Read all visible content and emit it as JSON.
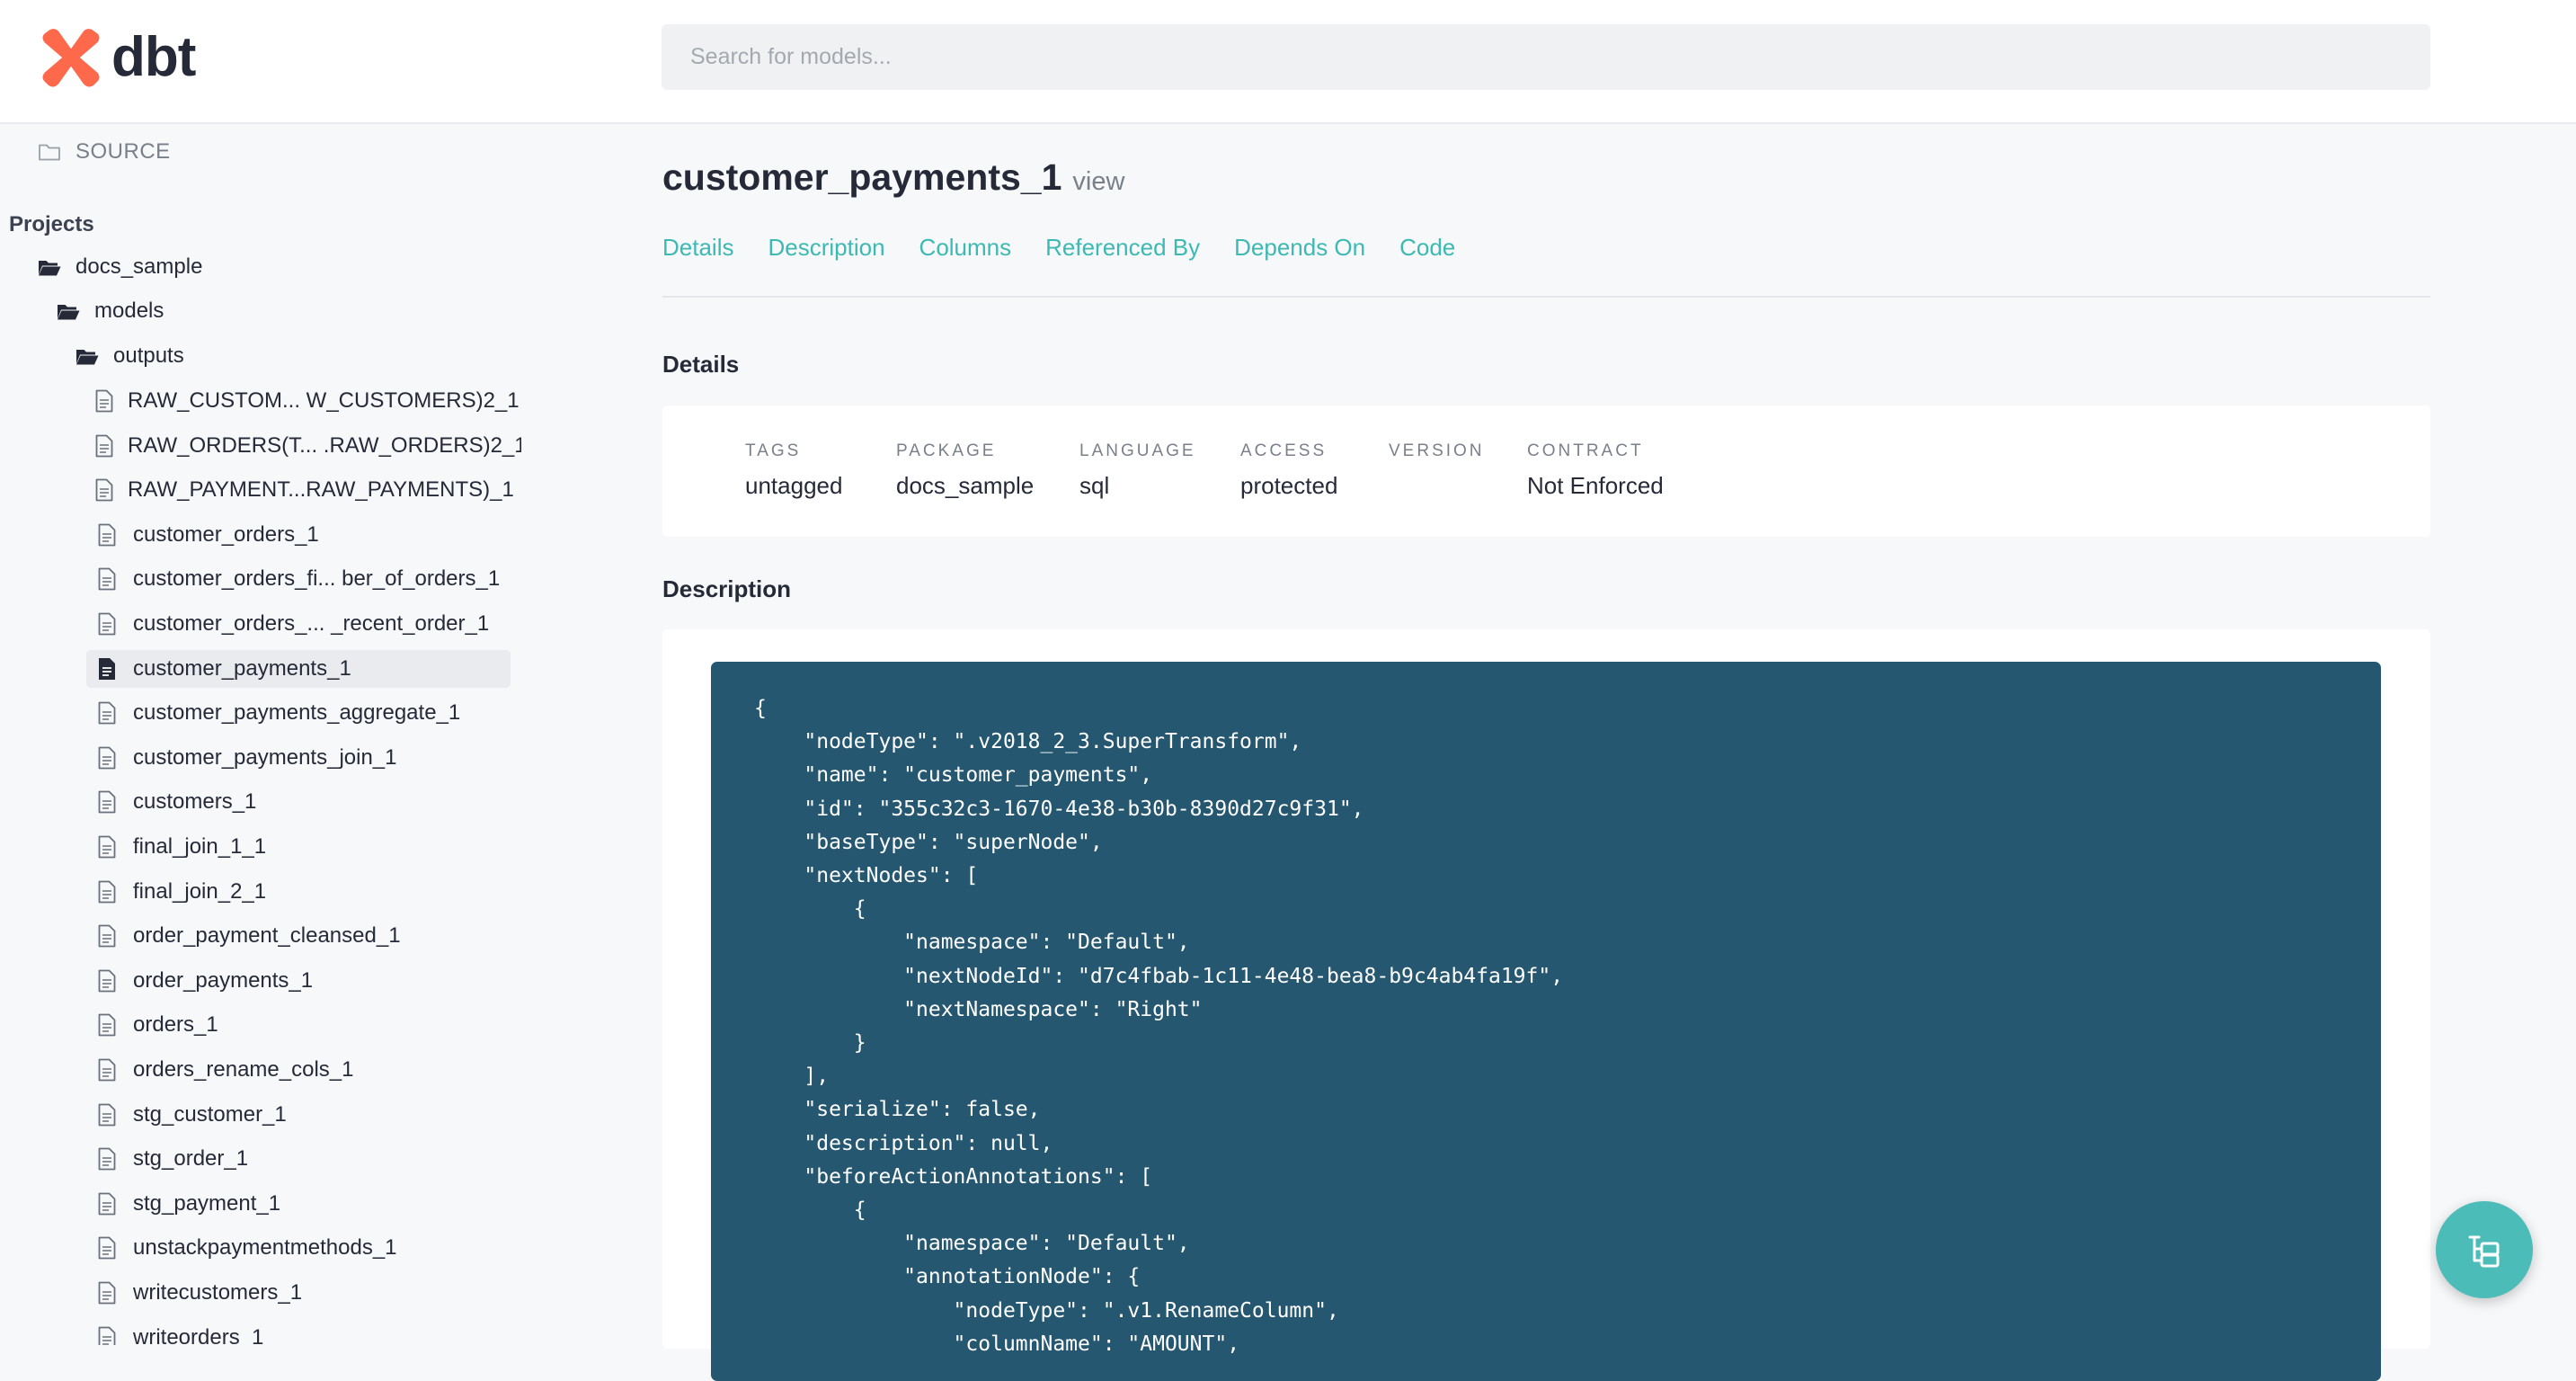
{
  "app": {
    "logo_text": "dbt",
    "brand_color": "#ff694b",
    "accent_color": "#3db9b4"
  },
  "search": {
    "placeholder": "Search for models..."
  },
  "sidebar": {
    "source_label": "SOURCE",
    "projects_heading": "Projects",
    "project_name": "docs_sample",
    "models_folder": "models",
    "outputs_folder": "outputs",
    "files": [
      "RAW_CUSTOM... W_CUSTOMERS)2_1",
      "RAW_ORDERS(T... .RAW_ORDERS)2_1",
      "RAW_PAYMENT...RAW_PAYMENTS)_1",
      "customer_orders_1",
      "customer_orders_fi... ber_of_orders_1",
      "customer_orders_...  _recent_order_1",
      "customer_payments_1",
      "customer_payments_aggregate_1",
      "customer_payments_join_1",
      "customers_1",
      "final_join_1_1",
      "final_join_2_1",
      "order_payment_cleansed_1",
      "order_payments_1",
      "orders_1",
      "orders_rename_cols_1",
      "stg_customer_1",
      "stg_order_1",
      "stg_payment_1",
      "unstackpaymentmethods_1",
      "writecustomers_1",
      "writeorders_1"
    ],
    "active_file": "customer_payments_1"
  },
  "main": {
    "title": "customer_payments_1",
    "kind": "view",
    "tabs": [
      "Details",
      "Description",
      "Columns",
      "Referenced By",
      "Depends On",
      "Code"
    ],
    "details_heading": "Details",
    "details": [
      {
        "key": "TAGS",
        "value": "untagged"
      },
      {
        "key": "PACKAGE",
        "value": "docs_sample"
      },
      {
        "key": "LANGUAGE",
        "value": "sql"
      },
      {
        "key": "ACCESS",
        "value": "protected"
      },
      {
        "key": "VERSION",
        "value": ""
      },
      {
        "key": "CONTRACT",
        "value": "Not Enforced"
      }
    ],
    "description_heading": "Description",
    "description_code": "{\n    \"nodeType\": \".v2018_2_3.SuperTransform\",\n    \"name\": \"customer_payments\",\n    \"id\": \"355c32c3-1670-4e38-b30b-8390d27c9f31\",\n    \"baseType\": \"superNode\",\n    \"nextNodes\": [\n        {\n            \"namespace\": \"Default\",\n            \"nextNodeId\": \"d7c4fbab-1c11-4e48-bea8-b9c4ab4fa19f\",\n            \"nextNamespace\": \"Right\"\n        }\n    ],\n    \"serialize\": false,\n    \"description\": null,\n    \"beforeActionAnnotations\": [\n        {\n            \"namespace\": \"Default\",\n            \"annotationNode\": {\n                \"nodeType\": \".v1.RenameColumn\",\n                \"columnName\": \"AMOUNT\","
  },
  "icons": {
    "source": "folder-outline-icon",
    "folder": "folder-open-icon",
    "file": "file-text-icon",
    "fab": "lineage-tree-icon"
  }
}
